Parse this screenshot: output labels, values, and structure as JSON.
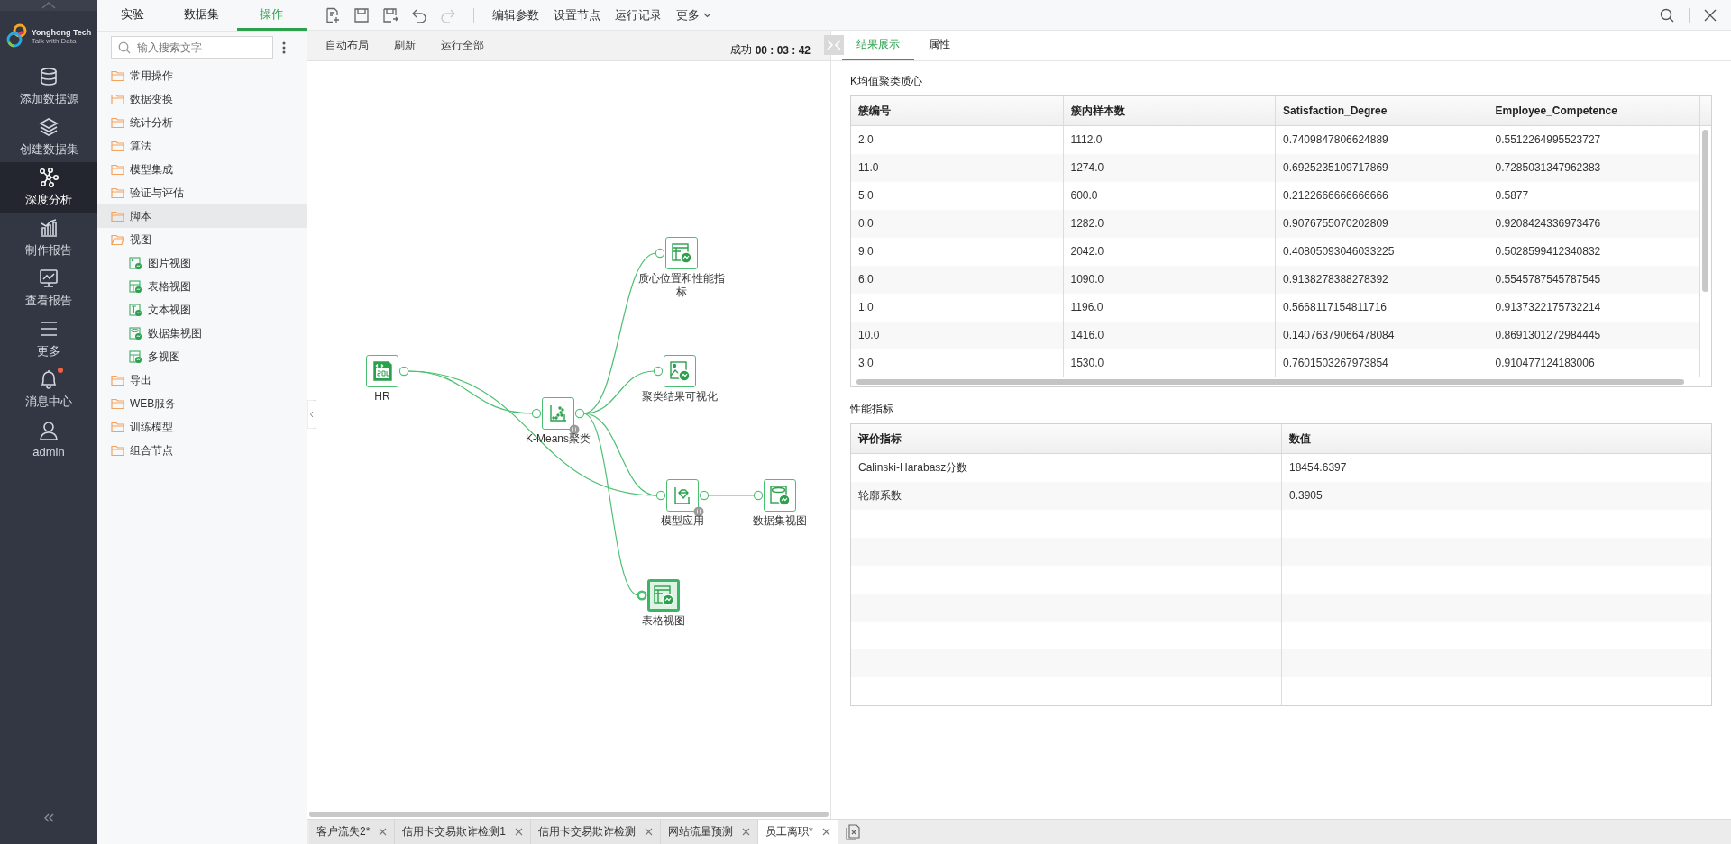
{
  "nav": {
    "logo": {
      "name": "Yonghong Tech",
      "tagline": "Talk with Data"
    },
    "items": [
      {
        "kind": "database",
        "label": "添加数据源",
        "selected": false,
        "dot": false
      },
      {
        "kind": "layers",
        "label": "创建数据集",
        "selected": false,
        "dot": false
      },
      {
        "kind": "graph",
        "label": "深度分析",
        "selected": true,
        "dot": false
      },
      {
        "kind": "chart",
        "label": "制作报告",
        "selected": false,
        "dot": false
      },
      {
        "kind": "monitor",
        "label": "查看报告",
        "selected": false,
        "dot": false
      },
      {
        "kind": "menu",
        "label": "更多",
        "selected": false,
        "dot": false
      },
      {
        "kind": "bell",
        "label": "消息中心",
        "selected": false,
        "dot": true
      },
      {
        "kind": "user",
        "label": "admin",
        "selected": false,
        "dot": false
      }
    ]
  },
  "tree_panel": {
    "tabs": [
      {
        "label": "实验",
        "selected": false
      },
      {
        "label": "数据集",
        "selected": false
      },
      {
        "label": "操作",
        "selected": true
      }
    ],
    "search": {
      "placeholder": "输入搜索文字"
    },
    "items": [
      {
        "kind": "folder",
        "label": "常用操作",
        "selected": false,
        "expanded": false
      },
      {
        "kind": "folder",
        "label": "数据变换",
        "selected": false,
        "expanded": false
      },
      {
        "kind": "folder",
        "label": "统计分析",
        "selected": false,
        "expanded": false
      },
      {
        "kind": "folder",
        "label": "算法",
        "selected": false,
        "expanded": false
      },
      {
        "kind": "folder",
        "label": "模型集成",
        "selected": false,
        "expanded": false
      },
      {
        "kind": "folder",
        "label": "验证与评估",
        "selected": false,
        "expanded": false
      },
      {
        "kind": "folder",
        "label": "脚本",
        "selected": true,
        "expanded": false
      },
      {
        "kind": "folder",
        "label": "视图",
        "selected": false,
        "expanded": true,
        "children": [
          {
            "kind": "image-view",
            "label": "图片视图",
            "selected": false
          },
          {
            "kind": "table-view",
            "label": "表格视图",
            "selected": false
          },
          {
            "kind": "text-view",
            "label": "文本视图",
            "selected": false
          },
          {
            "kind": "dataset-view",
            "label": "数据集视图",
            "selected": false
          },
          {
            "kind": "multi-view",
            "label": "多视图",
            "selected": false
          }
        ]
      },
      {
        "kind": "folder",
        "label": "导出",
        "selected": false,
        "expanded": false
      },
      {
        "kind": "folder",
        "label": "WEB服务",
        "selected": false,
        "expanded": false
      },
      {
        "kind": "folder",
        "label": "训练模型",
        "selected": false,
        "expanded": false
      },
      {
        "kind": "folder",
        "label": "组合节点",
        "selected": false,
        "expanded": false
      }
    ]
  },
  "toolbar": {
    "icon_buttons": [
      {
        "kind": "new",
        "disabled": false
      },
      {
        "kind": "save",
        "disabled": false
      },
      {
        "kind": "save-as",
        "disabled": false
      },
      {
        "kind": "undo",
        "disabled": false
      },
      {
        "kind": "redo",
        "disabled": true
      }
    ],
    "menu": [
      {
        "label": "编辑参数",
        "dropdown": false
      },
      {
        "label": "设置节点",
        "dropdown": false
      },
      {
        "label": "运行记录",
        "dropdown": false
      },
      {
        "label": "更多",
        "dropdown": true
      }
    ]
  },
  "canvas_bar": {
    "actions": [
      "自动布局",
      "刷新",
      "运行全部"
    ],
    "status": "成功",
    "elapsed": "00 : 03 : 42"
  },
  "flow": {
    "nodes": [
      {
        "kind": "sql",
        "label": "HR",
        "selected": false,
        "badge": false
      },
      {
        "kind": "cluster",
        "label": "K-Means聚类",
        "selected": false,
        "badge": true
      },
      {
        "kind": "table-view",
        "label": "质心位置和性能指标",
        "selected": false,
        "badge": false
      },
      {
        "kind": "image-view",
        "label": "聚类结果可视化",
        "selected": false,
        "badge": false
      },
      {
        "kind": "model-apply",
        "label": "模型应用",
        "selected": false,
        "badge": true
      },
      {
        "kind": "dataset-view",
        "label": "数据集视图",
        "selected": false,
        "badge": false
      },
      {
        "kind": "table-view",
        "label": "表格视图",
        "selected": true,
        "badge": false
      }
    ]
  },
  "result_panel": {
    "tabs": [
      {
        "label": "结果展示",
        "selected": true
      },
      {
        "label": "属性",
        "selected": false
      }
    ],
    "sections": [
      {
        "title": "K均值聚类质心",
        "columns": [
          "簇编号",
          "簇内样本数",
          "Satisfaction_Degree",
          "Employee_Competence"
        ],
        "rows": [
          [
            "2.0",
            "1112.0",
            "0.7409847806624889",
            "0.5512264995523727"
          ],
          [
            "11.0",
            "1274.0",
            "0.6925235109717869",
            "0.7285031347962383"
          ],
          [
            "5.0",
            "600.0",
            "0.2122666666666666",
            "0.5877"
          ],
          [
            "0.0",
            "1282.0",
            "0.9076755070202809",
            "0.9208424336973476"
          ],
          [
            "9.0",
            "2042.0",
            "0.40805093046033225",
            "0.5028599412340832"
          ],
          [
            "6.0",
            "1090.0",
            "0.9138278388278392",
            "0.5545787545787545"
          ],
          [
            "1.0",
            "1196.0",
            "0.5668117154811716",
            "0.9137322175732214"
          ],
          [
            "10.0",
            "1416.0",
            "0.14076379066478084",
            "0.8691301272984445"
          ],
          [
            "3.0",
            "1530.0",
            "0.7601503267973854",
            "0.910477124183006"
          ]
        ]
      },
      {
        "title": "性能指标",
        "columns": [
          "评价指标",
          "数值"
        ],
        "rows": [
          [
            "Calinski-Harabasz分数",
            "18454.6397"
          ],
          [
            "轮廓系数",
            "0.3905"
          ]
        ]
      }
    ]
  },
  "doc_tabs": [
    {
      "label": "客户流失2*",
      "selected": false
    },
    {
      "label": "信用卡交易欺诈检测1",
      "selected": false
    },
    {
      "label": "信用卡交易欺诈检测",
      "selected": false
    },
    {
      "label": "网站流量预测",
      "selected": false
    },
    {
      "label": "员工离职*",
      "selected": true
    }
  ]
}
